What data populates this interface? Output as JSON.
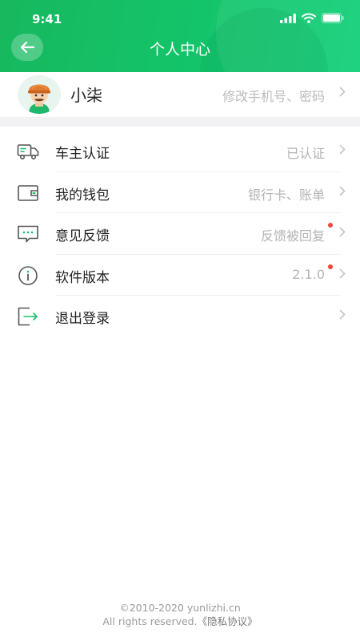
{
  "status_bar": {
    "time": "9:41"
  },
  "header": {
    "title": "个人中心"
  },
  "profile": {
    "name": "小柒",
    "action": "修改手机号、密码"
  },
  "menu": [
    {
      "label": "车主认证",
      "value": "已认证",
      "icon": "truck-icon",
      "has_dot": false
    },
    {
      "label": "我的钱包",
      "value": "银行卡、账单",
      "icon": "wallet-icon",
      "has_dot": false
    },
    {
      "label": "意见反馈",
      "value": "反馈被回复",
      "icon": "feedback-icon",
      "has_dot": true
    },
    {
      "label": "软件版本",
      "value": "2.1.0",
      "icon": "info-icon",
      "has_dot": true
    },
    {
      "label": "退出登录",
      "value": "",
      "icon": "logout-icon",
      "has_dot": false
    }
  ],
  "footer": {
    "copyright": "©2010-2020 yunlizhi.cn",
    "rights": "All rights reserved.",
    "privacy_link": "《隐私协议》"
  },
  "colors": {
    "brand_green": "#17c067",
    "icon_gray": "#555555",
    "dot_red": "#f0463a"
  }
}
